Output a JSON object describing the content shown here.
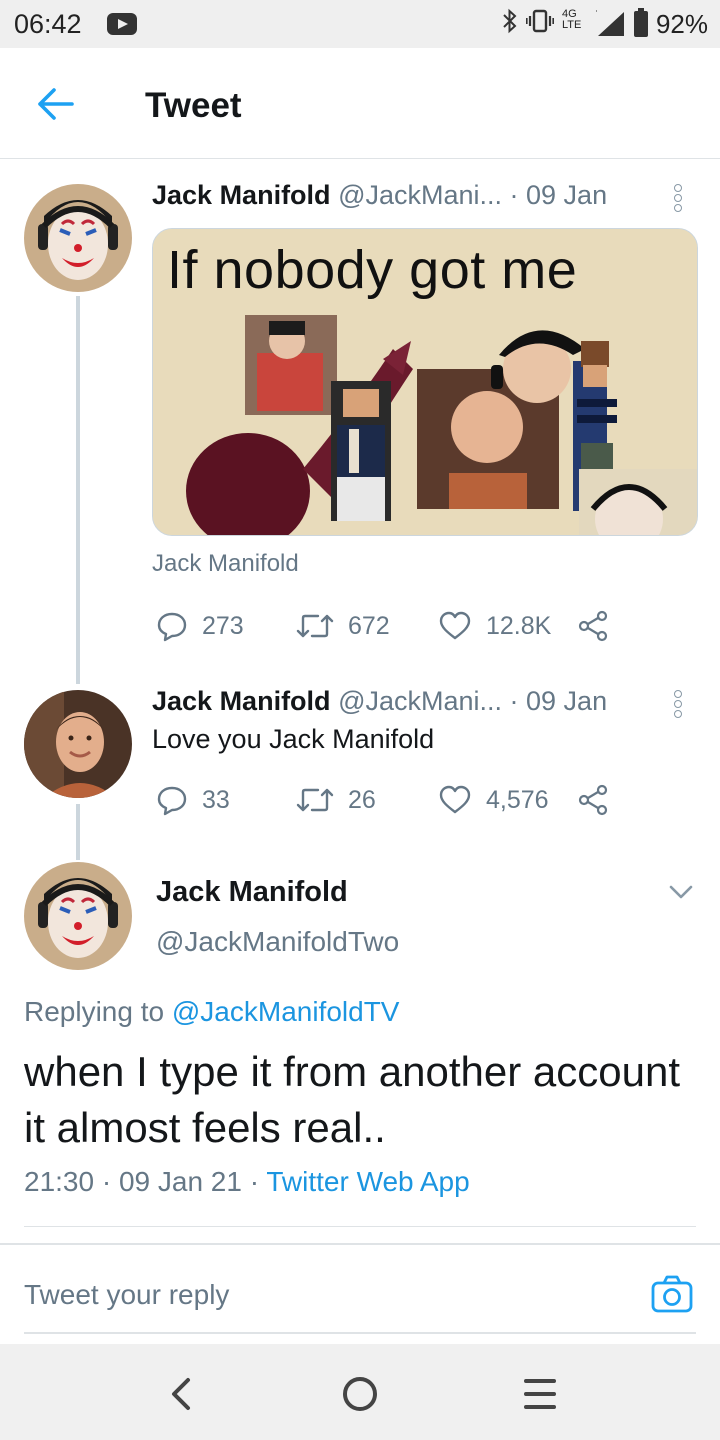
{
  "status_bar": {
    "time": "06:42",
    "network_top": "4G",
    "network_bottom": "LTE",
    "battery": "92%",
    "icons": [
      "youtube-icon",
      "bluetooth-icon",
      "vibrate-icon",
      "signal-icon",
      "battery-icon"
    ]
  },
  "header": {
    "title": "Tweet",
    "back_icon": "arrow-left-icon"
  },
  "tweets": [
    {
      "name": "Jack Manifold",
      "handle": "@JackMani...",
      "date": "· 09 Jan",
      "media_caption": "If nobody got me",
      "media_sub": "Jack Manifold",
      "replies": "273",
      "retweets": "672",
      "likes": "12.8K"
    },
    {
      "name": "Jack Manifold",
      "handle": "@JackMani...",
      "date": "· 09 Jan",
      "text": "Love you Jack Manifold",
      "replies": "33",
      "retweets": "26",
      "likes": "4,576"
    }
  ],
  "main_tweet": {
    "name": "Jack Manifold",
    "handle": "@JackManifoldTwo",
    "replying_prefix": "Replying to",
    "replying_to": "@JackManifoldTV",
    "text": "when I type it from another account it almost feels real..",
    "time": "21:30 · 09 Jan 21 ·",
    "source": "Twitter Web App"
  },
  "reply_box": {
    "placeholder": "Tweet your reply"
  },
  "colors": {
    "accent": "#1b95e0",
    "muted": "#657786",
    "text": "#14171a",
    "divider": "#dfe3e6"
  }
}
